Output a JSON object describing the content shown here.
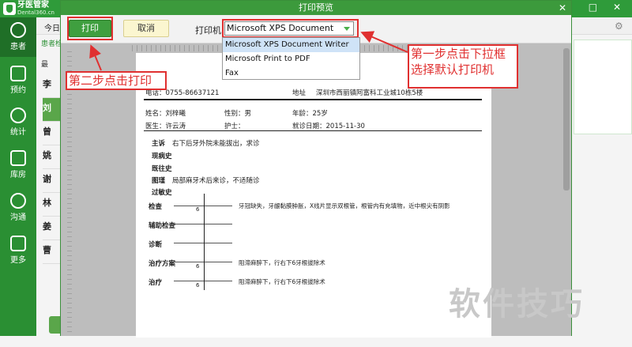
{
  "app": {
    "name": "牙医管家",
    "sub": "Dental360.cn",
    "window_controls": "♥ − □ ✕"
  },
  "sidebar": {
    "items": [
      {
        "label": "患者"
      },
      {
        "label": "预约"
      },
      {
        "label": "统计"
      },
      {
        "label": "库房"
      },
      {
        "label": "沟通"
      },
      {
        "label": "更多"
      }
    ]
  },
  "background": {
    "today": "今日",
    "search": "患者检",
    "recent": "最",
    "patients": [
      "李",
      "刘",
      "曾",
      "姚",
      "谢",
      "林",
      "姜",
      "曹"
    ]
  },
  "dialog": {
    "title": "打印预览",
    "close": "✕",
    "print_button": "打印",
    "cancel_button": "取消",
    "printer_label": "打印机",
    "printer_selected": "Microsoft XPS Document Writer",
    "printer_options": [
      "Microsoft XPS Document Writer",
      "Microsoft Print to PDF",
      "Fax"
    ]
  },
  "paper": {
    "phone": "电话：0755-86637121",
    "address_label": "地址",
    "address": "深圳市西丽镇阿富科工业城10栋5楼",
    "name": "姓名：刘梓曦",
    "gender": "性别：男",
    "age": "年龄：25岁",
    "doctor": "医生：许云涛",
    "nurse": "护士：",
    "date": "就诊日期：2015-11-30",
    "chief_label": "主诉",
    "chief_text": "右下后牙外院未能拔出，求诊",
    "present_label": "现病史",
    "past_label": "既往史",
    "allergy_label": "图瑾",
    "allergy_text": "局部麻牙术后来诊，不适随诊",
    "hist_label": "过敏史",
    "exam_label": "检查",
    "exam_tooth": "6",
    "exam_text": "牙冠缺失，牙龈黏膜肿胀，X线片显示双根管，根管内有充填物，近中根尖有阴影",
    "aux_label": "辅助检查",
    "diag_label": "诊断",
    "plan_label": "治疗方案",
    "plan_tooth": "6",
    "plan_text": "阻滞麻醉下，行右下6牙根拔除术",
    "treat_label": "治疗",
    "treat_tooth": "6",
    "treat_text": "阻滞麻醉下，行右下6牙根拔除术"
  },
  "annotations": {
    "step1": "第一步点击下拉框\n选择默认打印机",
    "step2": "第二步点击打印",
    "color": "#e03030"
  },
  "watermark": "软件技巧"
}
